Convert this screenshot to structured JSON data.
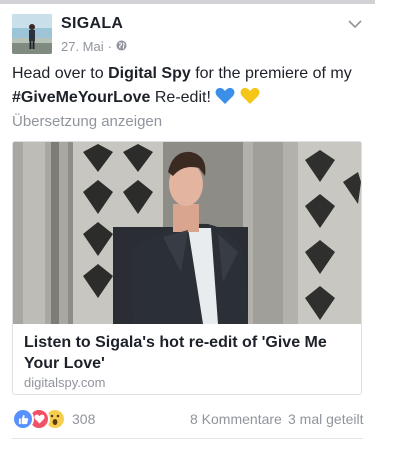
{
  "post": {
    "author": "SIGALA",
    "date": "27. Mai",
    "separator": "·",
    "privacy_icon": "globe-icon",
    "text_prefix": "Head over to ",
    "text_link": "Digital Spy",
    "text_middle": " for the premiere of my",
    "hashtag": "#GiveMeYourLove",
    "text_suffix": " Re-edit! ",
    "emojis": [
      "blue-heart",
      "yellow-heart"
    ],
    "translate_label": "Übersetzung anzeigen"
  },
  "link_card": {
    "title": "Listen to Sigala's hot re-edit of 'Give Me Your Love'",
    "domain": "digitalspy.com"
  },
  "footer": {
    "reaction_icons": [
      "like-icon",
      "love-icon",
      "wow-icon"
    ],
    "reaction_count": "308",
    "comments": "8 Kommentare",
    "shares": "3 mal geteilt"
  },
  "colors": {
    "text": "#1d2129",
    "secondary": "#90949c",
    "like": "#5890ff",
    "love": "#f25268",
    "wow": "#f7cd50",
    "blue_heart": "#3b8fe8",
    "yellow_heart": "#f5c518"
  }
}
